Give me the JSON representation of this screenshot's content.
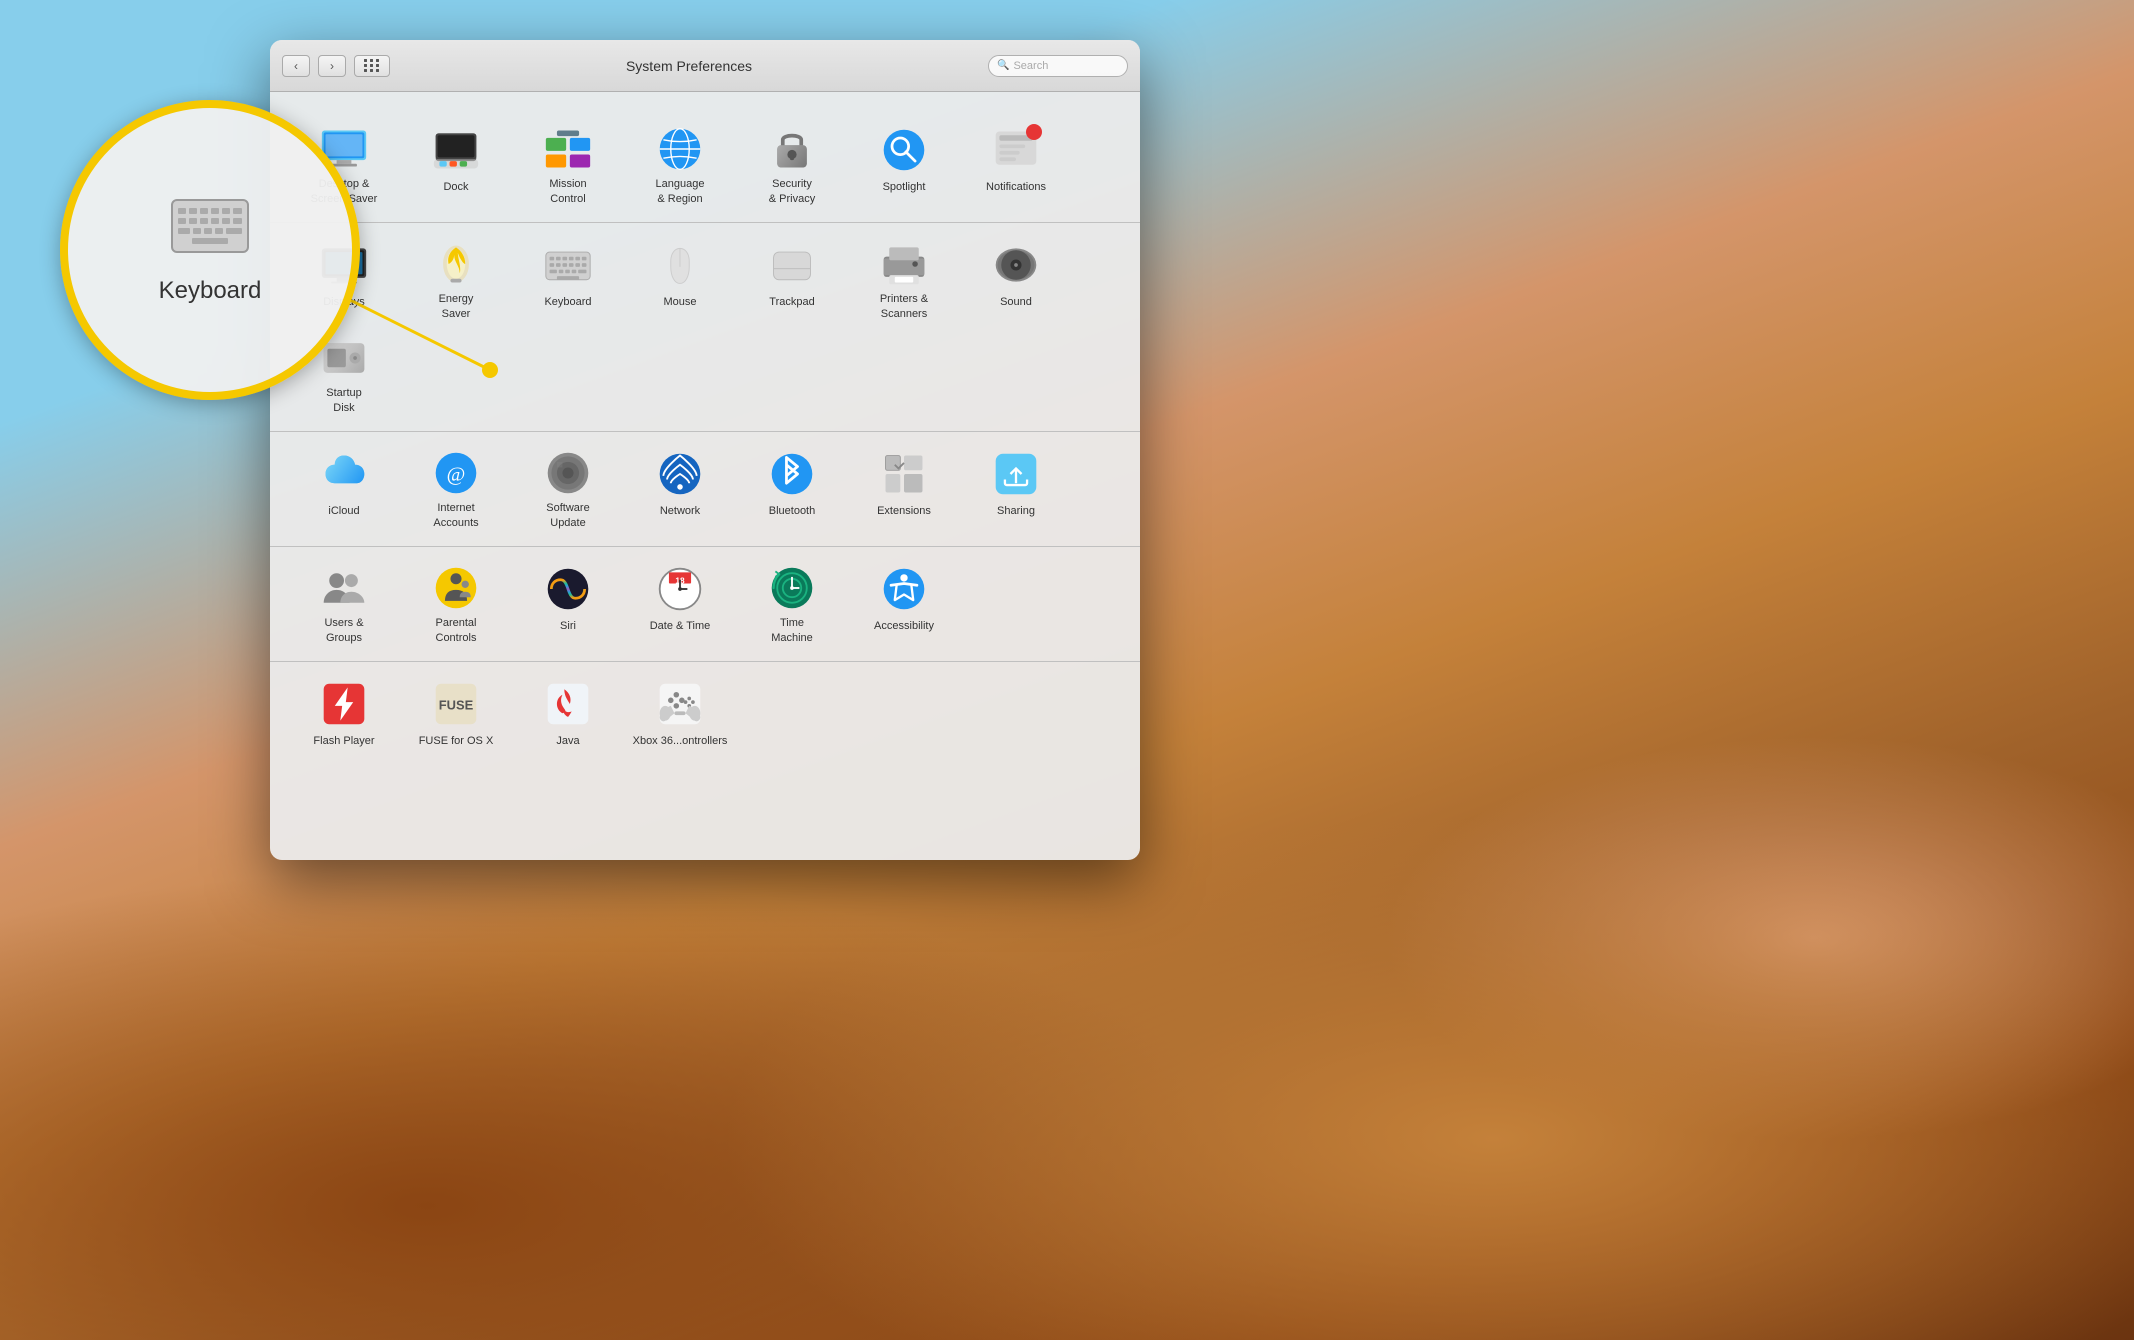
{
  "desktop": {
    "bg": "macOS Mojave desert"
  },
  "window": {
    "title": "System Preferences",
    "search_placeholder": "Search",
    "nav": {
      "back": "‹",
      "forward": "›"
    }
  },
  "spotlight": {
    "label": "Keyboard",
    "icon": "keyboard"
  },
  "sections": [
    {
      "id": "section1",
      "items": [
        {
          "id": "desktop-screensaver",
          "label": "Desktop &\nScreen Saver",
          "icon": "desktop"
        },
        {
          "id": "dock",
          "label": "Dock",
          "icon": "dock"
        },
        {
          "id": "mission-control",
          "label": "Mission\nControl",
          "icon": "mission"
        },
        {
          "id": "language-region",
          "label": "Language\n& Region",
          "icon": "language"
        },
        {
          "id": "security-privacy",
          "label": "Security\n& Privacy",
          "icon": "security"
        },
        {
          "id": "spotlight",
          "label": "Spotlight",
          "icon": "spotlight"
        },
        {
          "id": "notifications",
          "label": "Notifications",
          "icon": "notifications"
        }
      ]
    },
    {
      "id": "section2",
      "items": [
        {
          "id": "displays",
          "label": "Displays",
          "icon": "displays"
        },
        {
          "id": "energy-saver",
          "label": "Energy\nSaver",
          "icon": "energy"
        },
        {
          "id": "keyboard",
          "label": "Keyboard",
          "icon": "keyboard"
        },
        {
          "id": "mouse",
          "label": "Mouse",
          "icon": "mouse"
        },
        {
          "id": "trackpad",
          "label": "Trackpad",
          "icon": "trackpad"
        },
        {
          "id": "printers-scanners",
          "label": "Printers &\nScanners",
          "icon": "printers"
        },
        {
          "id": "sound",
          "label": "Sound",
          "icon": "sound"
        },
        {
          "id": "startup-disk",
          "label": "Startup\nDisk",
          "icon": "startup"
        }
      ]
    },
    {
      "id": "section3",
      "items": [
        {
          "id": "icloud",
          "label": "iCloud",
          "icon": "icloud"
        },
        {
          "id": "internet-accounts",
          "label": "Internet\nAccounts",
          "icon": "internet"
        },
        {
          "id": "software-update",
          "label": "Software\nUpdate",
          "icon": "software"
        },
        {
          "id": "network",
          "label": "Network",
          "icon": "network"
        },
        {
          "id": "bluetooth",
          "label": "Bluetooth",
          "icon": "bluetooth"
        },
        {
          "id": "extensions",
          "label": "Extensions",
          "icon": "extensions"
        },
        {
          "id": "sharing",
          "label": "Sharing",
          "icon": "sharing"
        }
      ]
    },
    {
      "id": "section4",
      "items": [
        {
          "id": "users-groups",
          "label": "Users &\nGroups",
          "icon": "users"
        },
        {
          "id": "parental-controls",
          "label": "Parental\nControls",
          "icon": "parental"
        },
        {
          "id": "siri",
          "label": "Siri",
          "icon": "siri"
        },
        {
          "id": "date-time",
          "label": "Date & Time",
          "icon": "datetime"
        },
        {
          "id": "time-machine",
          "label": "Time\nMachine",
          "icon": "timemachine"
        },
        {
          "id": "accessibility",
          "label": "Accessibility",
          "icon": "accessibility"
        }
      ]
    },
    {
      "id": "section5",
      "items": [
        {
          "id": "flash-player",
          "label": "Flash Player",
          "icon": "flash"
        },
        {
          "id": "fuse-osx",
          "label": "FUSE for OS X",
          "icon": "fuse"
        },
        {
          "id": "java",
          "label": "Java",
          "icon": "java"
        },
        {
          "id": "xbox-controllers",
          "label": "Xbox 36...ontrollers",
          "icon": "xbox"
        }
      ]
    }
  ]
}
